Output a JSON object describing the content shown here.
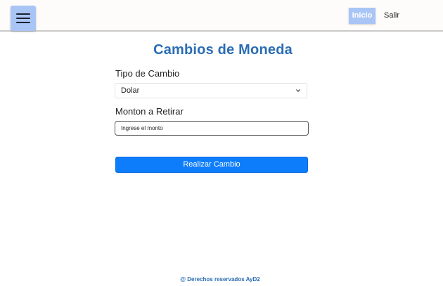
{
  "header": {
    "menu_icon": "hamburger-menu-icon",
    "nav_inicio": "Inicio",
    "nav_salir": "Salir"
  },
  "main": {
    "title": "Cambios de Moneda",
    "tipo_label": "Tipo de Cambio",
    "tipo_select": {
      "value": "Dolar",
      "icon": "chevron-down-icon"
    },
    "monto_label": "Monton a Retirar",
    "monto_input": {
      "value": "",
      "placeholder": "Ingrese el monto"
    },
    "submit_label": "Realizar Cambio"
  },
  "footer": {
    "text": "@ Derechos reservados AyD2"
  },
  "colors": {
    "accent_blue": "#0d7dfc",
    "title_blue": "#2a6db3",
    "nav_highlight": "#a9c5f5"
  }
}
